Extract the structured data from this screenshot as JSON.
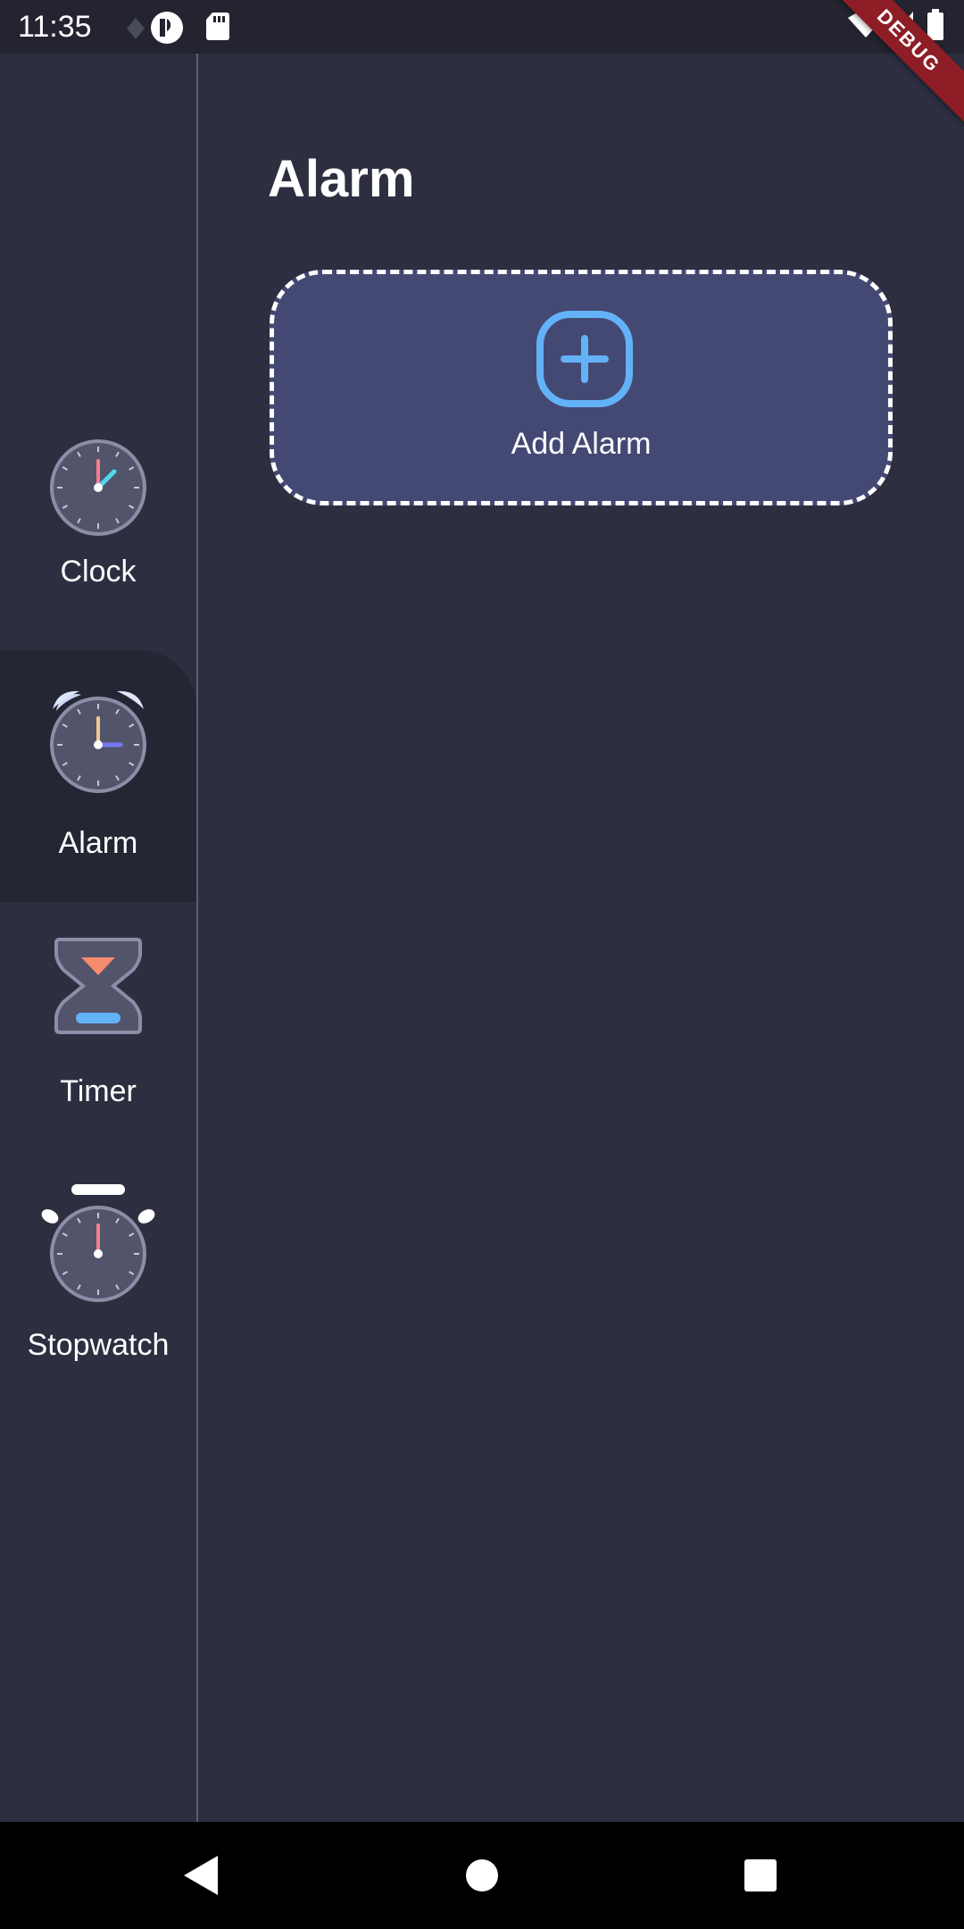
{
  "status_bar": {
    "time": "11:35",
    "icons": [
      "notification-dot-icon",
      "app-logo-icon",
      "sd-card-icon",
      "wifi-icon",
      "signal-icon",
      "battery-icon"
    ]
  },
  "debug_banner": {
    "label": "DEBUG",
    "color": "#8e1d25"
  },
  "sidebar": {
    "items": [
      {
        "label": "Clock",
        "icon": "clock-icon",
        "active": false
      },
      {
        "label": "Alarm",
        "icon": "alarm-icon",
        "active": true
      },
      {
        "label": "Timer",
        "icon": "hourglass-icon",
        "active": false
      },
      {
        "label": "Stopwatch",
        "icon": "stopwatch-icon",
        "active": false
      }
    ]
  },
  "main": {
    "title": "Alarm",
    "add_alarm": {
      "label": "Add Alarm",
      "icon": "add-icon"
    }
  },
  "navigation_bar": {
    "buttons": [
      "back-icon",
      "home-icon",
      "recents-icon"
    ]
  },
  "colors": {
    "background": "#2d2f41",
    "sidebar_active": "#242634",
    "card": "#444974",
    "accent_blue": "#63b2f7",
    "clock_pink": "#f57f8e",
    "clock_cyan": "#54d6f0",
    "alarm_yellow": "#f5c78e",
    "alarm_indigo": "#7477f5"
  }
}
